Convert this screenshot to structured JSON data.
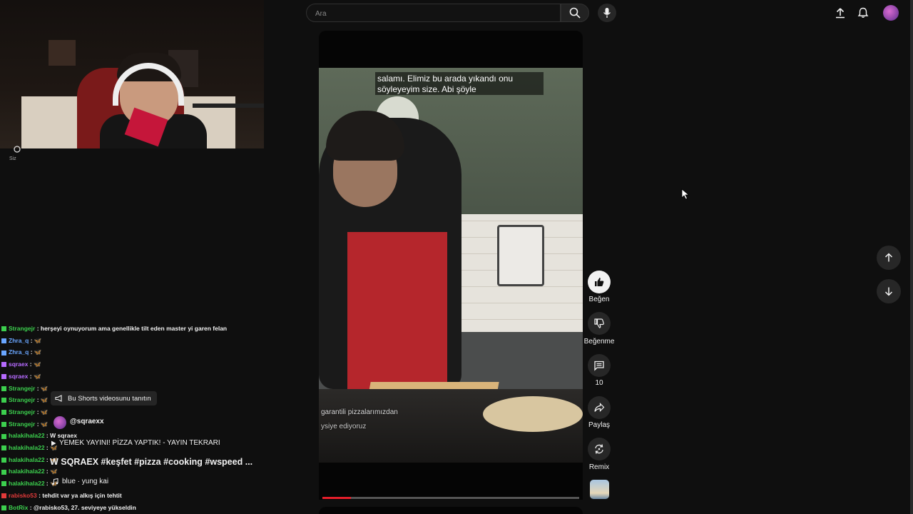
{
  "header": {
    "search_placeholder": "Ara",
    "icons": [
      "search-icon",
      "microphone-icon",
      "upload-icon",
      "bell-icon",
      "avatar"
    ]
  },
  "sidebar": {
    "you_label": "Siz"
  },
  "video": {
    "caption": "salamı. Elimiz bu arada yıkandı onu söyleyeyim size. Abi şöyle",
    "overlay_line1": "garantili pizzalarımızdan",
    "overlay_line2": "ysiye ediyoruz",
    "progress_percent": 11
  },
  "actions": {
    "like_label": "Beğen",
    "dislike_label": "Beğenme",
    "comments_count": "10",
    "share_label": "Paylaş",
    "remix_label": "Remix"
  },
  "shorts_info": {
    "promote_label": "Bu Shorts videosunu tanıtın",
    "channel": "@sqraexx",
    "related_video": "YEMEK YAYINI! PİZZA YAPTIK! - YAYIN TEKRARI",
    "description": "W SQRAEX #keşfet #pizza #cooking #wspeed ...",
    "music": "blue · yung kai"
  },
  "chat": [
    {
      "user": "Strangejr",
      "color": "#3ccf4e",
      "text": "herşeyi oynuyorum ama genellikle tilt eden master yi garen felan"
    },
    {
      "user": "Zhra_q",
      "color": "#6aa6ff",
      "text": "🦋"
    },
    {
      "user": "Zhra_q",
      "color": "#6aa6ff",
      "text": "🦋"
    },
    {
      "user": "sqraex",
      "color": "#b66bff",
      "text": "🦋"
    },
    {
      "user": "sqraex",
      "color": "#b66bff",
      "text": "🦋"
    },
    {
      "user": "Strangejr",
      "color": "#3ccf4e",
      "text": "🦋"
    },
    {
      "user": "Strangejr",
      "color": "#3ccf4e",
      "text": "🦋"
    },
    {
      "user": "Strangejr",
      "color": "#3ccf4e",
      "text": "🦋"
    },
    {
      "user": "Strangejr",
      "color": "#3ccf4e",
      "text": "🦋"
    },
    {
      "user": "halakihala22",
      "color": "#3ccf4e",
      "text": "W sqraex"
    },
    {
      "user": "halakihala22",
      "color": "#3ccf4e",
      "text": "🦋"
    },
    {
      "user": "halakihala22",
      "color": "#3ccf4e",
      "text": "🦋"
    },
    {
      "user": "halakihala22",
      "color": "#3ccf4e",
      "text": "🦋"
    },
    {
      "user": "halakihala22",
      "color": "#3ccf4e",
      "text": "🦋"
    },
    {
      "user": "rabisko53",
      "color": "#e23a3a",
      "text": "tehdit var ya alkış için tehtit"
    },
    {
      "user": "BotRix",
      "color": "#3ccf4e",
      "text": "@rabisko53, 27. seviyeye yükseldin"
    }
  ]
}
